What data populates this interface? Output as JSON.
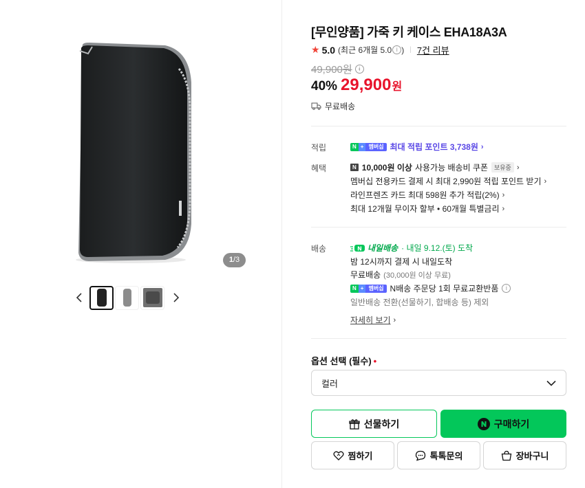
{
  "gallery": {
    "page_current": "1",
    "page_sep": "/",
    "page_total": "3",
    "thumbs": [
      "thumb-1",
      "thumb-2",
      "thumb-3"
    ]
  },
  "product": {
    "title": "[무인양품] 가죽 키 케이스 EHA18A3A",
    "rating_score": "5.0",
    "rating_recent": "(최근 6개월 5.0",
    "rating_recent_close": ")",
    "review_link": "7건 리뷰",
    "original_price": "49,900원",
    "discount": "40%",
    "sale_price": "29,900",
    "sale_unit": "원",
    "shipping_note": "무료배송"
  },
  "benefits": {
    "point_label": "적립",
    "point_badge_n": "N",
    "point_badge_plus": "+",
    "point_badge_member": "멤버십",
    "point_text": "최대 적립 포인트 3,738원",
    "benefit_label": "혜택",
    "coupon_badge": "N",
    "coupon_bold": "10,000원 이상",
    "coupon_text": "사용가능 배송비 쿠폰",
    "coupon_tag": "보유중",
    "card_line": "멤버십 전용카드 결제 시 최대 2,990원 적립 포인트 받기",
    "linefriends_line": "라인프렌즈 카드 최대 598원 추가 적립(2%)",
    "installment_line": "최대 12개월 무이자 할부 • 60개월 특별금리"
  },
  "delivery": {
    "label": "배송",
    "badge_text": "내일배송",
    "arrival": "· 내일 9.12.(토) 도착",
    "cutoff": "밤 12시까지 결제 시 내일도착",
    "free_ship": "무료배송",
    "free_ship_cond": "(30,000원 이상 무료)",
    "exchange_text": "N배송 주문당 1회 무료교환반품",
    "switch_text": "일반배송 전환(선물하기, 합배송 등) 제외",
    "detail_link": "자세히 보기"
  },
  "options": {
    "label": "옵션 선택 (필수)",
    "required_mark": "•",
    "color_select": "컬러"
  },
  "actions": {
    "gift": "선물하기",
    "buy": "구매하기",
    "wish": "찜하기",
    "talk": "톡톡문의",
    "cart": "장바구니"
  },
  "colors": {
    "accent_green": "#03c75a",
    "sale_red": "#e8132b",
    "point_purple": "#5a48e6"
  }
}
